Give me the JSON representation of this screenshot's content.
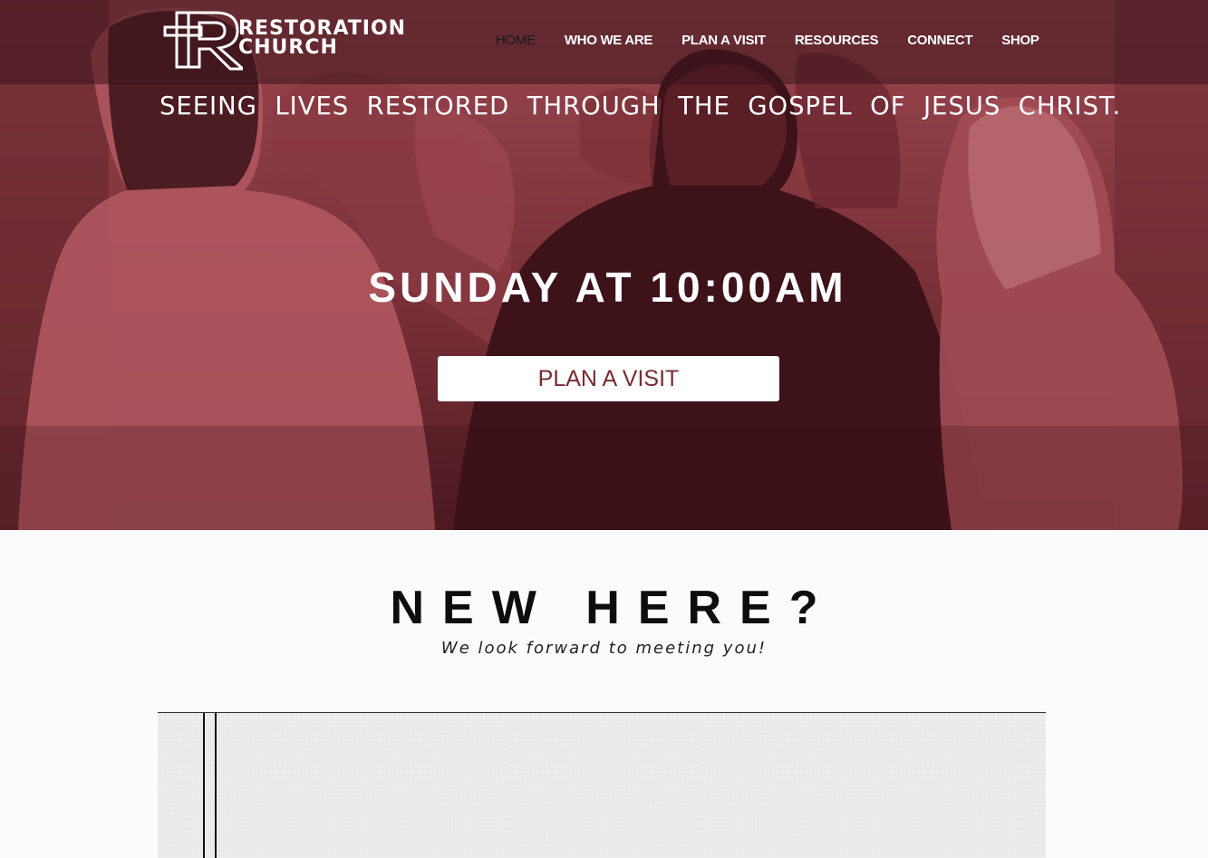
{
  "brand": {
    "line1": "RESTORATION",
    "line2": "CHURCH"
  },
  "nav": {
    "items": [
      {
        "label": "HOME",
        "active": true
      },
      {
        "label": "WHO WE ARE",
        "active": false
      },
      {
        "label": "PLAN A VISIT",
        "active": false
      },
      {
        "label": "RESOURCES",
        "active": false
      },
      {
        "label": "CONNECT",
        "active": false
      },
      {
        "label": "SHOP",
        "active": false
      }
    ]
  },
  "hero": {
    "tagline": "SEEING LIVES RESTORED THROUGH THE GOSPEL OF JESUS CHRIST.",
    "service_time": "SUNDAY AT 10:00AM",
    "cta_label": "PLAN A VISIT"
  },
  "new_here": {
    "title": "NEW HERE?",
    "subtitle": "We look forward to meeting you!"
  },
  "colors": {
    "hero_tint": "#7a2a33",
    "cta_text": "#7a2a33",
    "page_bg": "#fbfbfb"
  }
}
